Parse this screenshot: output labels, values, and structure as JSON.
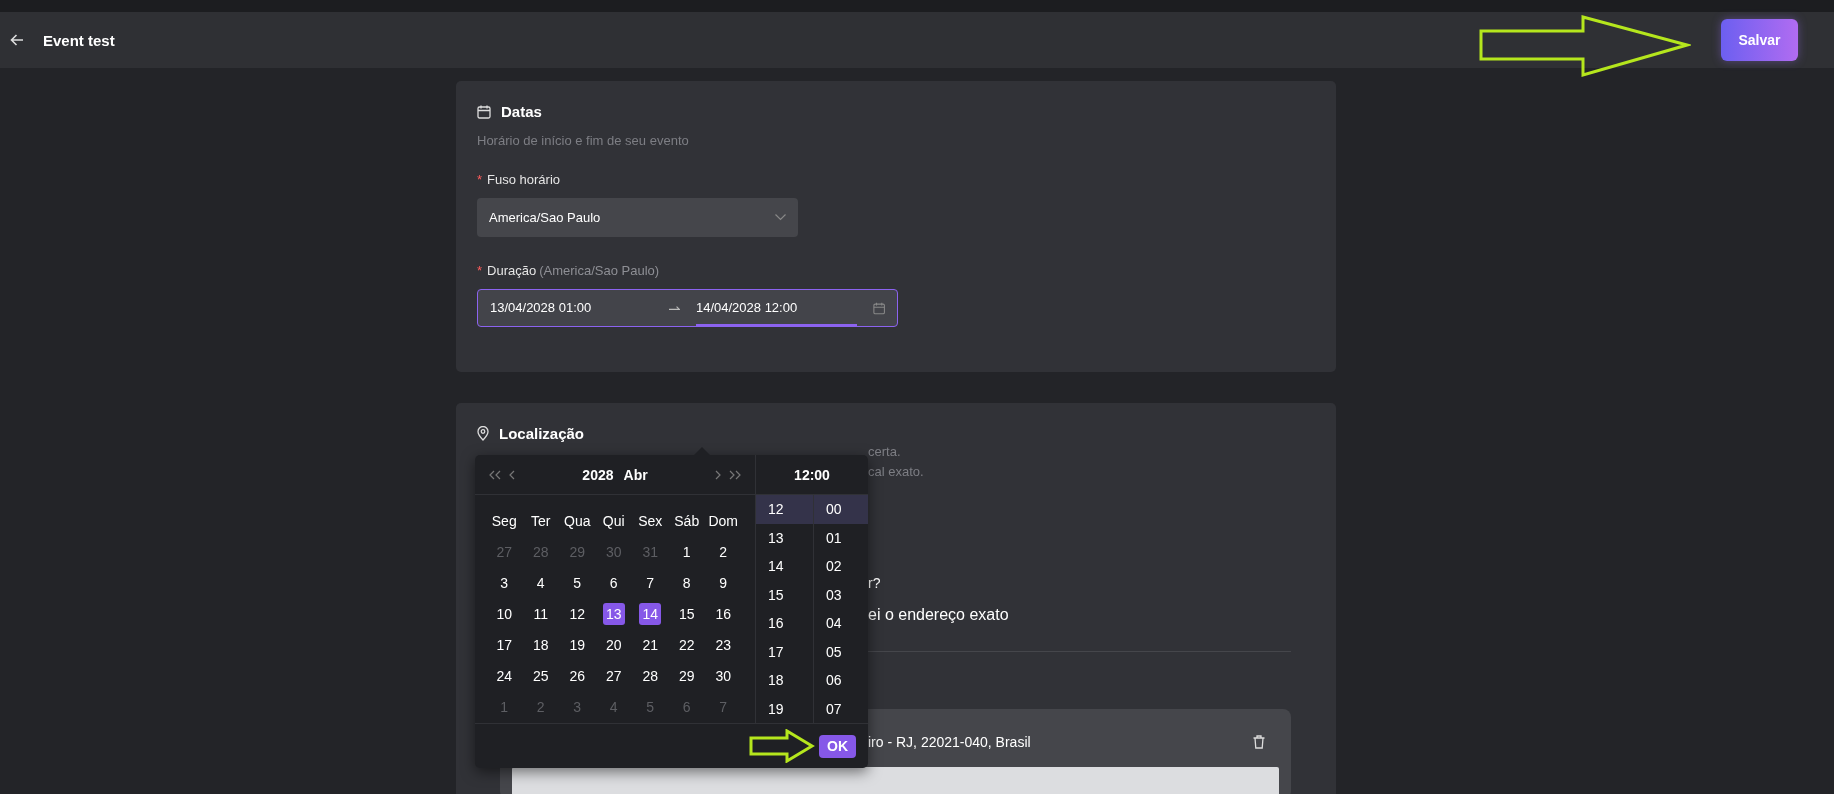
{
  "header": {
    "title": "Event test",
    "save_button": "Salvar"
  },
  "dates_section": {
    "title": "Datas",
    "subtitle": "Horário de início e fim de seu evento",
    "timezone": {
      "required_mark": "*",
      "label": "Fuso horário",
      "value": "America/Sao Paulo"
    },
    "duration": {
      "required_mark": "*",
      "label": "Duração",
      "hint": "(America/Sao Paulo)",
      "start": {
        "value": "13/04/2028 01:00",
        "selected": false
      },
      "end": {
        "value": "14/04/2028 12:00",
        "selected": true
      }
    }
  },
  "location_section": {
    "title": "Localização",
    "description_fragments": [
      "certa.",
      "cal exato."
    ],
    "question_fragment": "r?",
    "option_fragment": "ei o endereço exato",
    "address_fragment": "iro - RJ, 22021-040, Brasil"
  },
  "date_picker": {
    "year": "2028",
    "month": "Abr",
    "weekdays": [
      "Seg",
      "Ter",
      "Qua",
      "Qui",
      "Sex",
      "Sáb",
      "Dom"
    ],
    "days": [
      {
        "label": "27",
        "muted": true,
        "selected": false
      },
      {
        "label": "28",
        "muted": true,
        "selected": false
      },
      {
        "label": "29",
        "muted": true,
        "selected": false
      },
      {
        "label": "30",
        "muted": true,
        "selected": false
      },
      {
        "label": "31",
        "muted": true,
        "selected": false
      },
      {
        "label": "1",
        "muted": false,
        "selected": false
      },
      {
        "label": "2",
        "muted": false,
        "selected": false
      },
      {
        "label": "3",
        "muted": false,
        "selected": false
      },
      {
        "label": "4",
        "muted": false,
        "selected": false
      },
      {
        "label": "5",
        "muted": false,
        "selected": false
      },
      {
        "label": "6",
        "muted": false,
        "selected": false
      },
      {
        "label": "7",
        "muted": false,
        "selected": false
      },
      {
        "label": "8",
        "muted": false,
        "selected": false
      },
      {
        "label": "9",
        "muted": false,
        "selected": false
      },
      {
        "label": "10",
        "muted": false,
        "selected": false
      },
      {
        "label": "11",
        "muted": false,
        "selected": false
      },
      {
        "label": "12",
        "muted": false,
        "selected": false
      },
      {
        "label": "13",
        "muted": false,
        "selected": true
      },
      {
        "label": "14",
        "muted": false,
        "selected": true
      },
      {
        "label": "15",
        "muted": false,
        "selected": false
      },
      {
        "label": "16",
        "muted": false,
        "selected": false
      },
      {
        "label": "17",
        "muted": false,
        "selected": false
      },
      {
        "label": "18",
        "muted": false,
        "selected": false
      },
      {
        "label": "19",
        "muted": false,
        "selected": false
      },
      {
        "label": "20",
        "muted": false,
        "selected": false
      },
      {
        "label": "21",
        "muted": false,
        "selected": false
      },
      {
        "label": "22",
        "muted": false,
        "selected": false
      },
      {
        "label": "23",
        "muted": false,
        "selected": false
      },
      {
        "label": "24",
        "muted": false,
        "selected": false
      },
      {
        "label": "25",
        "muted": false,
        "selected": false
      },
      {
        "label": "26",
        "muted": false,
        "selected": false
      },
      {
        "label": "27",
        "muted": false,
        "selected": false
      },
      {
        "label": "28",
        "muted": false,
        "selected": false
      },
      {
        "label": "29",
        "muted": false,
        "selected": false
      },
      {
        "label": "30",
        "muted": false,
        "selected": false
      },
      {
        "label": "1",
        "muted": true,
        "selected": false
      },
      {
        "label": "2",
        "muted": true,
        "selected": false
      },
      {
        "label": "3",
        "muted": true,
        "selected": false
      },
      {
        "label": "4",
        "muted": true,
        "selected": false
      },
      {
        "label": "5",
        "muted": true,
        "selected": false
      },
      {
        "label": "6",
        "muted": true,
        "selected": false
      },
      {
        "label": "7",
        "muted": true,
        "selected": false
      }
    ],
    "time_display": "12:00",
    "hours": [
      {
        "label": "12",
        "selected": true
      },
      {
        "label": "13",
        "selected": false
      },
      {
        "label": "14",
        "selected": false
      },
      {
        "label": "15",
        "selected": false
      },
      {
        "label": "16",
        "selected": false
      },
      {
        "label": "17",
        "selected": false
      },
      {
        "label": "18",
        "selected": false
      },
      {
        "label": "19",
        "selected": false
      }
    ],
    "minutes": [
      {
        "label": "00",
        "selected": true
      },
      {
        "label": "01",
        "selected": false
      },
      {
        "label": "02",
        "selected": false
      },
      {
        "label": "03",
        "selected": false
      },
      {
        "label": "04",
        "selected": false
      },
      {
        "label": "05",
        "selected": false
      },
      {
        "label": "06",
        "selected": false
      },
      {
        "label": "07",
        "selected": false
      }
    ],
    "ok_button": "OK"
  }
}
